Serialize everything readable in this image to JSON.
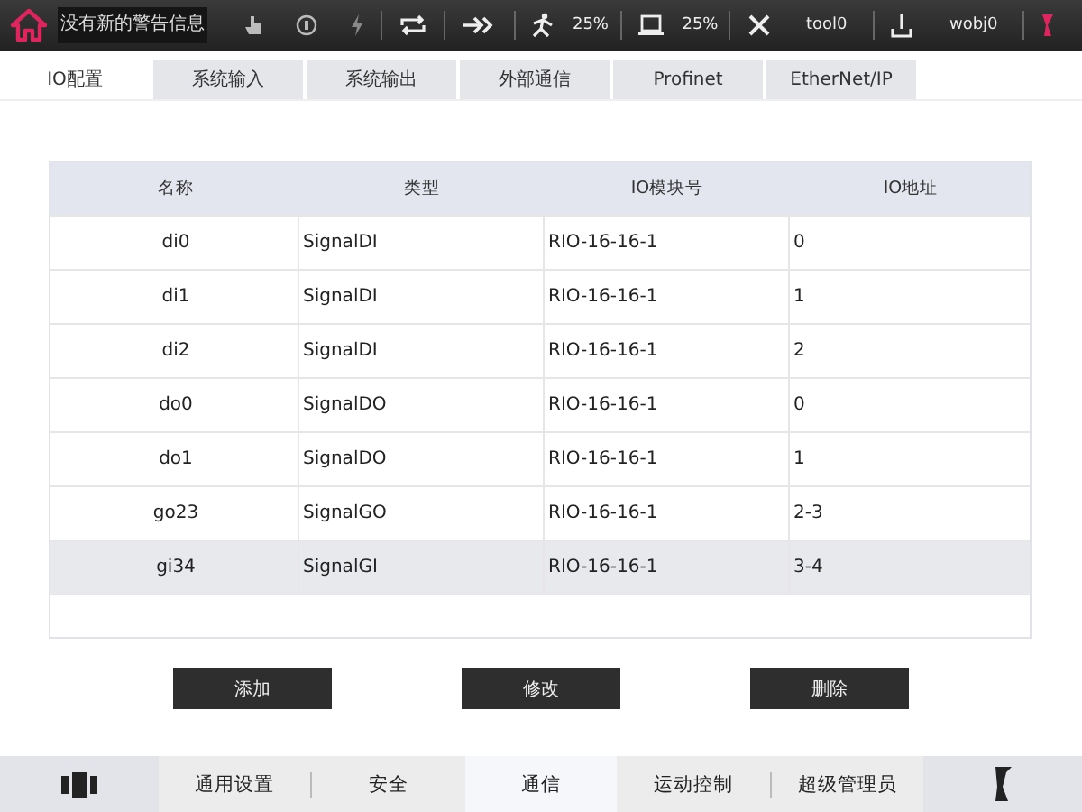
{
  "status_bar": {
    "message": "没有新的警告信息",
    "speed": "25%",
    "load": "25%",
    "tool": "tool0",
    "wobj": "wobj0"
  },
  "tabs": [
    {
      "label": "IO配置",
      "selected": true
    },
    {
      "label": "系统输入",
      "selected": false
    },
    {
      "label": "系统输出",
      "selected": false
    },
    {
      "label": "外部通信",
      "selected": false
    },
    {
      "label": "Profinet",
      "selected": false
    },
    {
      "label": "EtherNet/IP",
      "selected": false
    }
  ],
  "table": {
    "columns": [
      "名称",
      "类型",
      "IO模块号",
      "IO地址"
    ],
    "rows": [
      {
        "cells": [
          "di0",
          "SignalDI",
          "RIO-16-16-1",
          "0"
        ],
        "selected": false
      },
      {
        "cells": [
          "di1",
          "SignalDI",
          "RIO-16-16-1",
          "1"
        ],
        "selected": false
      },
      {
        "cells": [
          "di2",
          "SignalDI",
          "RIO-16-16-1",
          "2"
        ],
        "selected": false
      },
      {
        "cells": [
          "do0",
          "SignalDO",
          "RIO-16-16-1",
          "0"
        ],
        "selected": false
      },
      {
        "cells": [
          "do1",
          "SignalDO",
          "RIO-16-16-1",
          "1"
        ],
        "selected": false
      },
      {
        "cells": [
          "go23",
          "SignalGO",
          "RIO-16-16-1",
          "2-3"
        ],
        "selected": false
      },
      {
        "cells": [
          "gi34",
          "SignalGI",
          "RIO-16-16-1",
          "3-4"
        ],
        "selected": true
      }
    ]
  },
  "buttons": [
    "添加",
    "修改",
    "删除"
  ],
  "nav": [
    {
      "label": "通用设置",
      "selected": false
    },
    {
      "label": "安全",
      "selected": false
    },
    {
      "label": "通信",
      "selected": true
    },
    {
      "label": "运动控制",
      "selected": false
    },
    {
      "label": "超级管理员",
      "selected": false
    }
  ]
}
